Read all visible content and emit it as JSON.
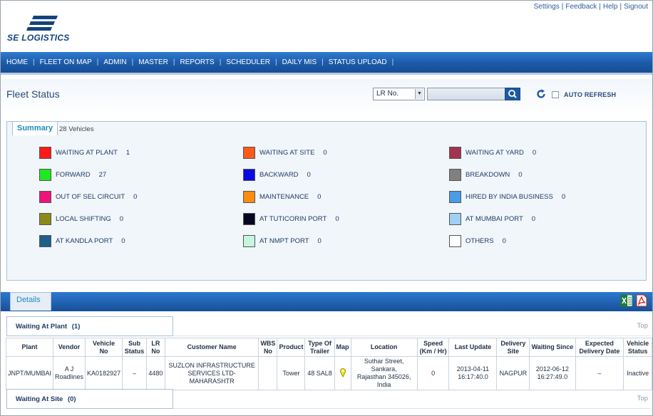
{
  "top_links": [
    "Settings",
    "Feedback",
    "Help",
    "Signout"
  ],
  "brand": {
    "name": "SE LOGISTICS",
    "color": "#14437d"
  },
  "nav": [
    "HOME",
    "FLEET ON MAP",
    "ADMIN",
    "MASTER",
    "REPORTS",
    "SCHEDULER",
    "DAILY MIS",
    "STATUS UPLOAD"
  ],
  "header": {
    "title": "Fleet Status",
    "search_type": "LR No.",
    "search_value": "",
    "auto_refresh_label": "AUTO REFRESH",
    "auto_refresh_checked": false
  },
  "summary": {
    "tab_label": "Summary",
    "vehicle_count": "28 Vehicles",
    "items": [
      {
        "label": "WAITING AT PLANT",
        "count": "1",
        "color": "#ff1a1a"
      },
      {
        "label": "WAITING AT SITE",
        "count": "0",
        "color": "#ff5a1a"
      },
      {
        "label": "WAITING AT YARD",
        "count": "0",
        "color": "#a23450"
      },
      {
        "label": "FORWARD",
        "count": "27",
        "color": "#1ee81e"
      },
      {
        "label": "BACKWARD",
        "count": "0",
        "color": "#0a0ae0"
      },
      {
        "label": "BREAKDOWN",
        "count": "0",
        "color": "#808080"
      },
      {
        "label": "OUT OF SEL CIRCUIT",
        "count": "0",
        "color": "#f0127a"
      },
      {
        "label": "MAINTENANCE",
        "count": "0",
        "color": "#ff8a12"
      },
      {
        "label": "HIRED BY INDIA BUSINESS",
        "count": "0",
        "color": "#4a9be8"
      },
      {
        "label": "LOCAL SHIFTING",
        "count": "0",
        "color": "#8a8a1a"
      },
      {
        "label": "AT TUTICORIN PORT",
        "count": "0",
        "color": "#070720"
      },
      {
        "label": "AT MUMBAI PORT",
        "count": "0",
        "color": "#9fd0f5"
      },
      {
        "label": "AT KANDLA PORT",
        "count": "0",
        "color": "#1f5f88"
      },
      {
        "label": "AT NMPT PORT",
        "count": "0",
        "color": "#c8f5e0"
      },
      {
        "label": "OTHERS",
        "count": "0",
        "color": "#ffffff"
      }
    ]
  },
  "details": {
    "tab_label": "Details",
    "top_label": "Top",
    "groups": [
      {
        "title": "Waiting At Plant",
        "count": "(1)"
      },
      {
        "title": "Waiting At Site",
        "count": "(0)"
      }
    ],
    "columns": [
      [
        "Plant"
      ],
      [
        "Vendor"
      ],
      [
        "Vehicle",
        "No"
      ],
      [
        "Sub",
        "Status"
      ],
      [
        "LR",
        "No"
      ],
      [
        "Customer Name"
      ],
      [
        "WBS",
        "No"
      ],
      [
        "Product"
      ],
      [
        "Type Of",
        "Trailer"
      ],
      [
        "Map"
      ],
      [
        "Location"
      ],
      [
        "Speed",
        "(Km / Hr)"
      ],
      [
        "Last Update"
      ],
      [
        "Delivery",
        "Site"
      ],
      [
        "Waiting Since"
      ],
      [
        "Expected",
        "Delivery Date"
      ],
      [
        "Vehicle",
        "Status"
      ]
    ],
    "rows": [
      {
        "plant": "JNPT/MUMBAI",
        "vendor": [
          "A J",
          "Roadlines"
        ],
        "vehicle_no": "KA0182927",
        "sub_status": "–",
        "lr_no": "4480",
        "customer": [
          "SUZLON INFRASTRUCTURE",
          "SERVICES LTD-MAHARASHTR"
        ],
        "wbs_no": "",
        "product": "Tower",
        "trailer": "48 SAL8",
        "location": [
          "Suthar Street, Sankara,",
          "Rajasthan 345026, India"
        ],
        "speed": "0",
        "last_update": [
          "2013-04-11",
          "16:17:40.0"
        ],
        "delivery_site": "NAGPUR",
        "waiting_since": [
          "2012-06-12",
          "16:27:49.0"
        ],
        "expected_delivery": "–",
        "vehicle_status": "Inactive"
      }
    ]
  }
}
